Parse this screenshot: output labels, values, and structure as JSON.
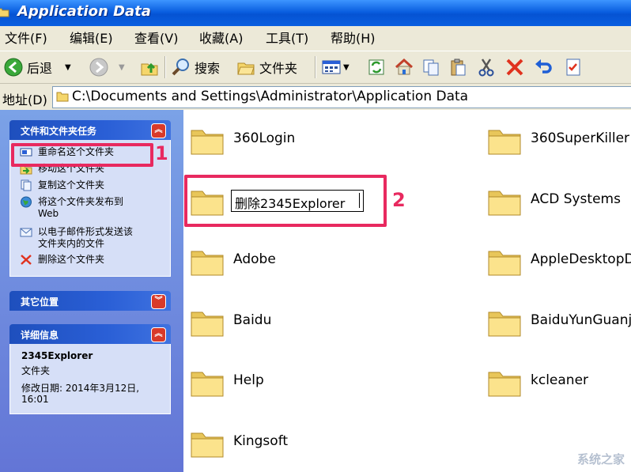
{
  "window": {
    "title": "Application Data"
  },
  "menu": {
    "items": [
      "文件(F)",
      "编辑(E)",
      "查看(V)",
      "收藏(A)",
      "工具(T)",
      "帮助(H)"
    ]
  },
  "toolbar": {
    "back_label": "后退",
    "search_label": "搜索",
    "folders_label": "文件夹"
  },
  "address": {
    "label": "地址(D)",
    "path": "C:\\Documents and Settings\\Administrator\\Application Data"
  },
  "tasks_panel": {
    "title": "文件和文件夹任务",
    "items": [
      {
        "label": "重命名这个文件夹",
        "icon": "rename-icon"
      },
      {
        "label": "移动这个文件夹",
        "icon": "move-icon"
      },
      {
        "label": "复制这个文件夹",
        "icon": "copy-icon"
      },
      {
        "label": "将这个文件夹发布到",
        "label2": "Web",
        "icon": "globe-icon"
      },
      {
        "label": "以电子邮件形式发送该",
        "label2": "文件夹内的文件",
        "icon": "email-icon"
      },
      {
        "label": "删除这个文件夹",
        "icon": "delete-icon"
      }
    ]
  },
  "other_places_panel": {
    "title": "其它位置"
  },
  "details_panel": {
    "title": "详细信息",
    "name": "2345Explorer",
    "type": "文件夹",
    "modified": "修改日期: 2014年3月12日,",
    "modified_time": "16:01"
  },
  "folders": [
    {
      "name": "360Login"
    },
    {
      "name": "360SuperKiller"
    },
    {
      "name": "删除2345Explorer",
      "editing": true
    },
    {
      "name": "ACD Systems"
    },
    {
      "name": "Adobe"
    },
    {
      "name": "AppleDesktopD"
    },
    {
      "name": "Baidu"
    },
    {
      "name": "BaiduYunGuanji"
    },
    {
      "name": "Help"
    },
    {
      "name": "kcleaner"
    },
    {
      "name": "Kingsoft"
    }
  ],
  "annotations": {
    "step1": "1",
    "step2": "2"
  },
  "watermark": "系统之家",
  "colors": {
    "highlight": "#e8295f",
    "titlebar": "#0a5fe0",
    "pane": "#6f8fe0"
  }
}
